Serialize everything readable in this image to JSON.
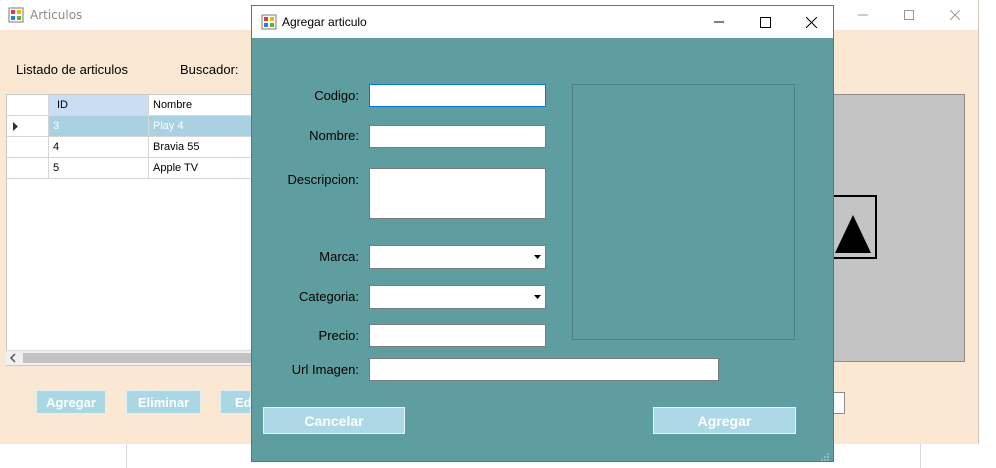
{
  "bg_window": {
    "title": "Articulos",
    "listado_label": "Listado de articulos",
    "buscador_label": "Buscador:",
    "grid": {
      "columns": [
        "ID",
        "Nombre"
      ],
      "rows": [
        {
          "id": "3",
          "nombre": "Play 4"
        },
        {
          "id": "4",
          "nombre": "Bravia 55"
        },
        {
          "id": "5",
          "nombre": "Apple TV"
        }
      ]
    },
    "buttons": {
      "agregar": "Agregar",
      "eliminar": "Eliminar",
      "editar_partial": "Ed"
    }
  },
  "dialog": {
    "title": "Agregar articulo",
    "labels": {
      "codigo": "Codigo:",
      "nombre": "Nombre:",
      "descripcion": "Descripcion:",
      "marca": "Marca:",
      "categoria": "Categoria:",
      "precio": "Precio:",
      "url_imagen": "Url Imagen:"
    },
    "values": {
      "codigo": "",
      "nombre": "",
      "descripcion": "",
      "marca": "",
      "categoria": "",
      "precio": "",
      "url_imagen": ""
    },
    "buttons": {
      "cancelar": "Cancelar",
      "agregar": "Agregar"
    }
  },
  "colors": {
    "dialog_bg": "#5f9ea0",
    "bg_window": "#fae8d3",
    "button_light_blue": "#add8e6",
    "selected_row": "#aad1e2"
  },
  "icons": [
    "app-icon",
    "minimize-icon",
    "maximize-icon",
    "close-icon",
    "row-pointer-icon",
    "dropdown-arrow-icon",
    "scroll-left-icon",
    "image-placeholder-icon",
    "resize-grip-icon"
  ]
}
